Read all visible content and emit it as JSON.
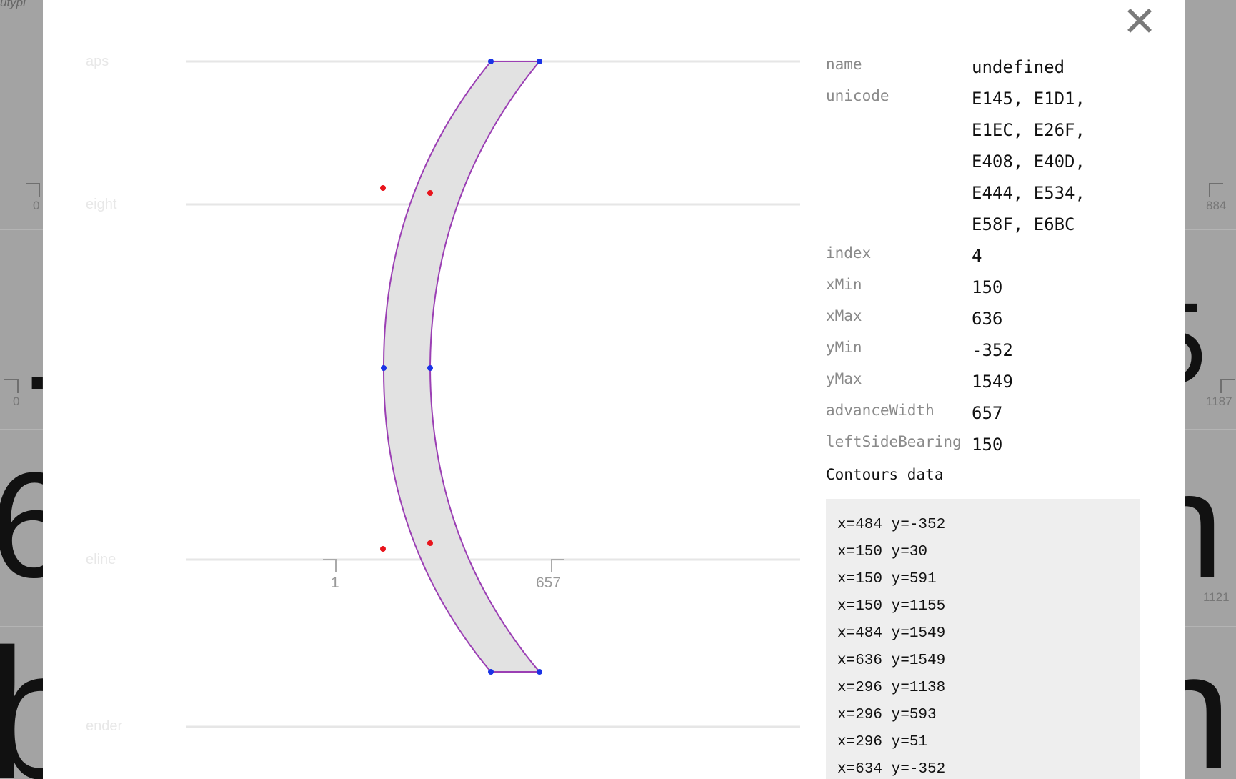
{
  "background": {
    "title_fragment": "utypi",
    "glyph_fragments": [
      "6",
      "b",
      "h",
      "n",
      "5",
      "."
    ],
    "markers": [
      "0",
      "884",
      "0",
      "1187",
      "1121"
    ]
  },
  "modal": {
    "close_label": "✕",
    "guides": {
      "caps": "aps",
      "x_height": "eight",
      "baseline": "eline",
      "descender": "ender"
    },
    "bearing_markers": {
      "left": "1",
      "right": "657"
    },
    "info": [
      {
        "key": "name",
        "value": "undefined"
      },
      {
        "key": "unicode",
        "value": "E145, E1D1, E1EC, E26F, E408, E40D, E444, E534, E58F, E6BC"
      },
      {
        "key": "index",
        "value": "4"
      },
      {
        "key": "xMin",
        "value": "150"
      },
      {
        "key": "xMax",
        "value": "636"
      },
      {
        "key": "yMin",
        "value": "-352"
      },
      {
        "key": "yMax",
        "value": "1549"
      },
      {
        "key": "advanceWidth",
        "value": "657"
      },
      {
        "key": "leftSideBearing",
        "value": "150"
      }
    ],
    "contours_title": "Contours data",
    "contours": [
      "x=484 y=-352",
      "x=150 y=30",
      "x=150 y=591",
      "x=150 y=1155",
      "x=484 y=1549",
      "x=636 y=1549",
      "x=296 y=1138",
      "x=296 y=593",
      "x=296 y=51",
      "x=634 y=-352"
    ]
  },
  "colors": {
    "outline": "#9b3fb4",
    "fill": "#e2e2e2",
    "on_curve_point": "#1a33e6",
    "off_curve_point": "#e8141c",
    "guide_line": "#e6e6e6"
  }
}
